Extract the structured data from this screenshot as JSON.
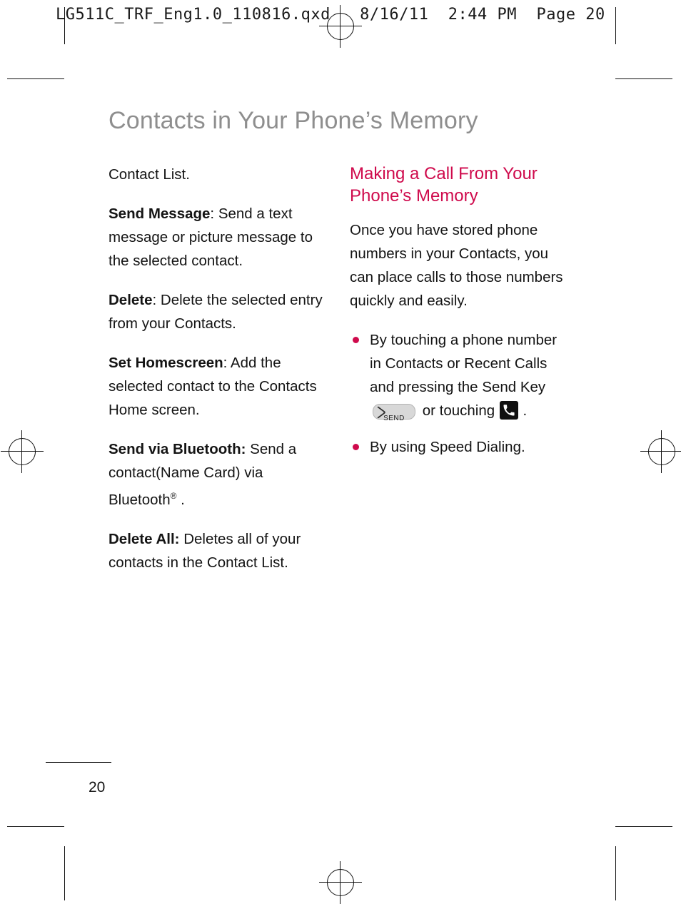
{
  "print_header": "LG511C_TRF_Eng1.0_110816.qxd   8/16/11  2:44 PM  Page 20",
  "page_title": "Contacts in Your Phone’s Memory",
  "page_number": "20",
  "left_column": {
    "paragraphs": [
      {
        "label": "",
        "text": "Contact List."
      },
      {
        "label": "Send Message",
        "text": ": Send a text message or picture message to the selected contact."
      },
      {
        "label": "Delete",
        "text": ": Delete the selected entry from your Contacts."
      },
      {
        "label": "Set Homescreen",
        "text": ":  Add the selected contact to the Contacts Home screen."
      },
      {
        "label": "Send via Bluetooth:",
        "text": " Send a contact(Name Card) via Bluetooth"
      },
      {
        "label": "Delete All:",
        "text": " Deletes all of your contacts in the Contact List."
      }
    ],
    "bluetooth_superscript": "®",
    "bluetooth_trailing": " ."
  },
  "right_column": {
    "heading": "Making a Call From Your Phone’s Memory",
    "intro": "Once you have stored phone numbers in your Contacts, you can place calls to those numbers quickly and easily.",
    "bullets": [
      {
        "text_before": "By touching a phone number in Contacts or Recent Calls and pressing the Send Key",
        "key_label": "SEND",
        "text_middle": "or touching",
        "text_after": "."
      },
      {
        "text_before": "By using Speed Dialing.",
        "key_label": "",
        "text_middle": "",
        "text_after": ""
      }
    ]
  },
  "colors": {
    "accent": "#cf0a4c",
    "title_gray": "#8e8e8e",
    "body": "#141414"
  },
  "icons": {
    "send_key": "send-key-icon",
    "phone_handset": "phone-handset-icon"
  }
}
